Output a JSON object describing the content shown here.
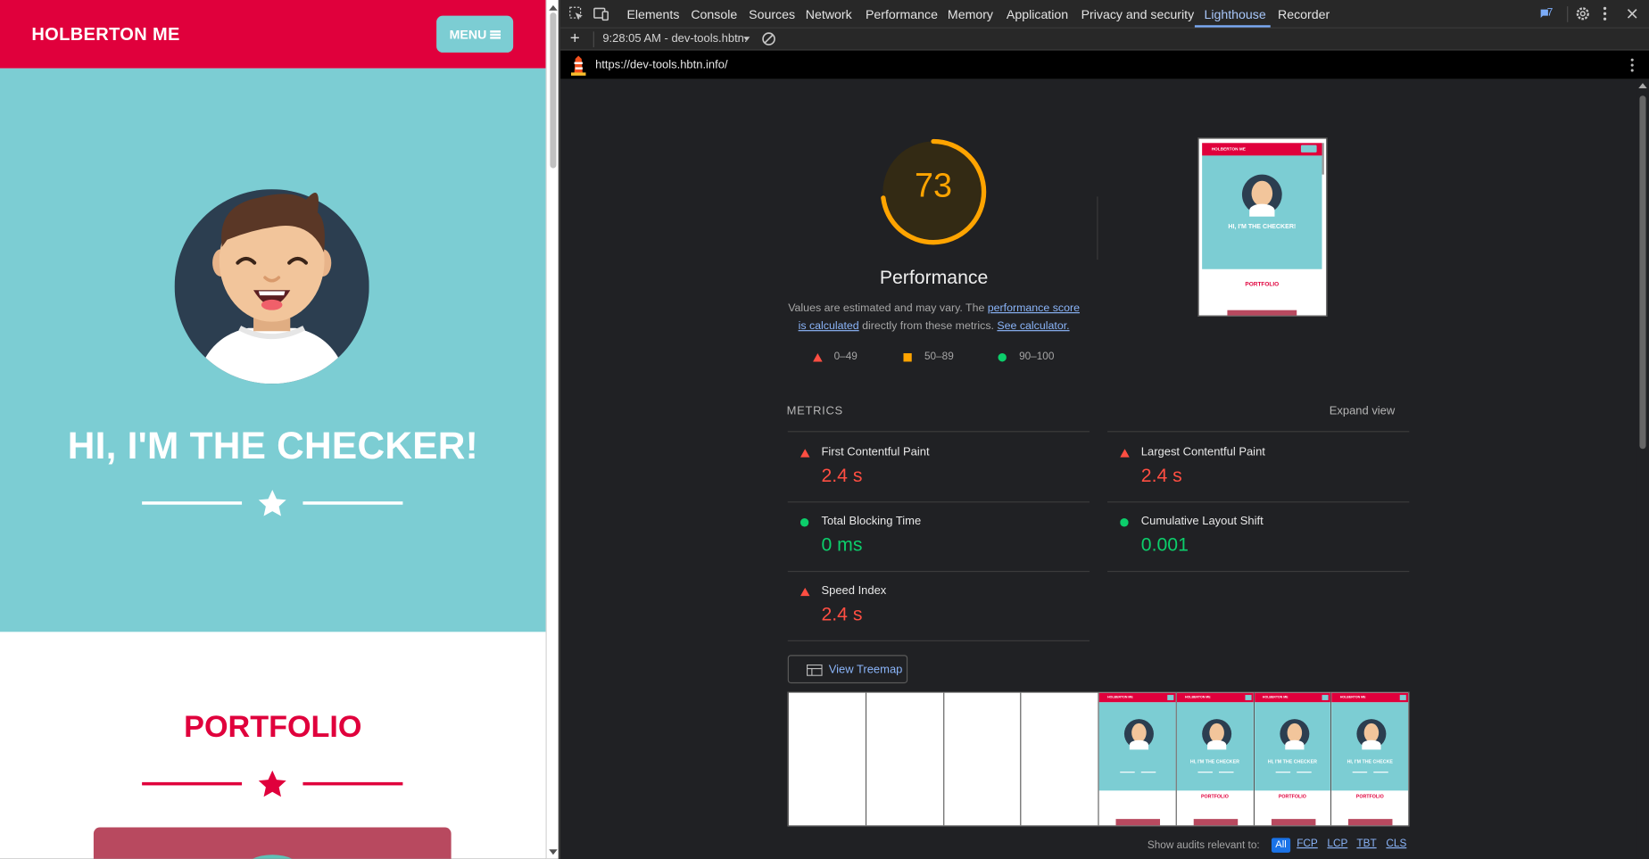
{
  "site": {
    "title": "HOLBERTON ME",
    "menu_label": "MENU",
    "hero_title": "HI, I'M THE CHECKER!",
    "portfolio_title": "PORTFOLIO",
    "colors": {
      "brand_red": "#e0003c",
      "teal": "#7ccdd3"
    }
  },
  "devtools": {
    "tabs": [
      "Elements",
      "Console",
      "Sources",
      "Network",
      "Performance",
      "Memory",
      "Application",
      "Privacy and security",
      "Lighthouse",
      "Recorder"
    ],
    "active_tab": "Lighthouse",
    "issues_count": "7",
    "run_label": "9:28:05 AM - dev-tools.hbtn.",
    "url": "https://dev-tools.hbtn.info/"
  },
  "lighthouse": {
    "score": "73",
    "score_value": 0.73,
    "category": "Performance",
    "desc_pre": "Values are estimated and may vary. The ",
    "desc_link1": "performance score is calculated",
    "desc_mid": " directly from these metrics. ",
    "desc_link2": "See calculator.",
    "legend": [
      {
        "icon": "triangle",
        "label": "0–49",
        "color": "#ff4e42"
      },
      {
        "icon": "square",
        "label": "50–89",
        "color": "#ffa400"
      },
      {
        "icon": "circle",
        "label": "90–100",
        "color": "#0cce6b"
      }
    ],
    "metrics_label": "METRICS",
    "expand_label": "Expand view",
    "metrics": [
      {
        "title": "First Contentful Paint",
        "value": "2.4 s",
        "status": "fail"
      },
      {
        "title": "Largest Contentful Paint",
        "value": "2.4 s",
        "status": "fail"
      },
      {
        "title": "Total Blocking Time",
        "value": "0 ms",
        "status": "pass"
      },
      {
        "title": "Cumulative Layout Shift",
        "value": "0.001",
        "status": "pass"
      },
      {
        "title": "Speed Index",
        "value": "2.4 s",
        "status": "fail"
      }
    ],
    "treemap_label": "View Treemap",
    "thumb": {
      "title": "HOLBERTON ME",
      "hero": "HI, I'M THE CHECKER!",
      "section": "PORTFOLIO"
    },
    "filmstrip_blank_frames": 4,
    "filmstrip_frames": [
      {
        "title": "HOLBERTON ME",
        "hero": "",
        "section": ""
      },
      {
        "title": "HOLBERTON ME",
        "hero": "HI, I'M THE CHECKER",
        "section": "PORTFOLIO"
      },
      {
        "title": "HOLBERTON ME",
        "hero": "HI, I'M THE CHECKER",
        "section": "PORTFOLIO"
      },
      {
        "title": "HOLBERTON ME",
        "hero": "HI, I'M THE CHECKE",
        "section": "PORTFOLIO"
      }
    ],
    "audits_label": "Show audits relevant to:",
    "audit_filters": [
      "All",
      "FCP",
      "LCP",
      "TBT",
      "CLS"
    ],
    "colors": {
      "fail": "#ff4e42",
      "average": "#ffa400",
      "pass": "#0cce6b",
      "link": "#8ab4f8"
    }
  }
}
